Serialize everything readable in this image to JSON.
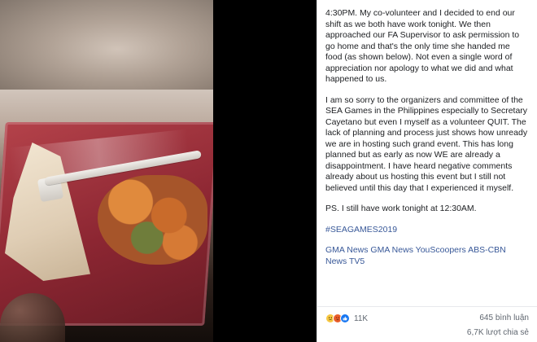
{
  "post": {
    "paragraphs": [
      "4:30PM. My co-volunteer and I decided to end our shift as we both have work tonight. We then approached our FA Supervisor to ask permission to go home and that's the only time she handed me food (as shown below). Not even a single word of appreciation nor apology to what we did and what happened to us.",
      "I am so sorry to the organizers and committee of the SEA Games in the Philippines especially to Secretary Cayetano but even I myself as a volunteer QUIT. The lack of planning and process just shows how unready we are in hosting such grand event. This has long planned but as early as now WE are already a disappointment. I have heard negative comments already about us hosting this event but I still not believed until this day that I experienced it myself.",
      "PS. I still have work tonight at 12:30AM."
    ],
    "hashtag": "#SEAGAMES2019",
    "tagged": "GMA News GMA News YouScoopers ABS-CBN News TV5"
  },
  "footer": {
    "reaction_icons": [
      "sad-reaction-icon",
      "angry-reaction-icon",
      "like-reaction-icon"
    ],
    "reaction_count": "11K",
    "comments": "645 bình luận",
    "shares": "6,7K lượt chia sẻ"
  },
  "colors": {
    "link": "#385898",
    "text": "#1c1e21",
    "muted": "#606770",
    "sad": "#f7c842",
    "angry": "#e95d2a",
    "like": "#1877f2"
  }
}
